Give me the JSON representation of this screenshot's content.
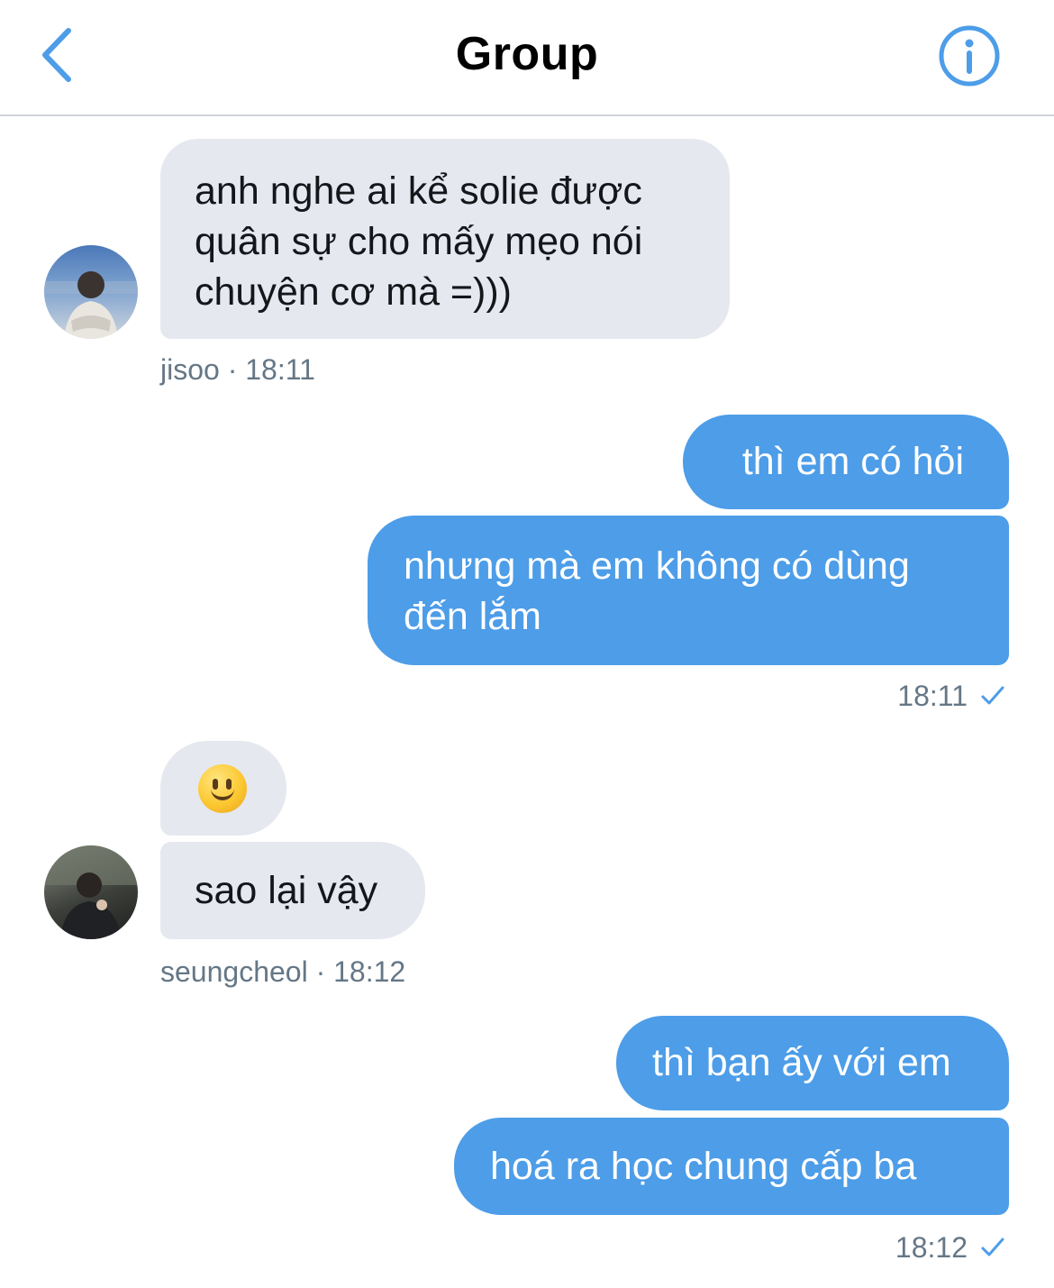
{
  "header": {
    "title": "Group",
    "back_icon": "chevron-left-icon",
    "info_icon": "info-icon",
    "accent": "#4d9de8"
  },
  "messages": [
    {
      "text": "anh nghe ai kể solie được quân sự cho mấy mẹo nói chuyện cơ mà =)))",
      "direction": "incoming"
    },
    {
      "text": "thì em có hỏi",
      "direction": "outgoing"
    },
    {
      "text": "nhưng mà em không có dùng đến lắm",
      "direction": "outgoing"
    },
    {
      "emoji": "slightly-smiling-face-icon",
      "direction": "incoming"
    },
    {
      "text": "sao lại vậy",
      "direction": "incoming"
    },
    {
      "text": "thì bạn ấy với em",
      "direction": "outgoing"
    },
    {
      "text": "hoá ra học chung cấp ba",
      "direction": "outgoing"
    }
  ],
  "meta": {
    "group1": {
      "sender": "jisoo",
      "sep": " · ",
      "time": "18:11"
    },
    "group2": {
      "time": "18:11",
      "icon": "checkmark-icon"
    },
    "group3": {
      "sender": "seungcheol",
      "sep": "  · ",
      "time": "18:12"
    },
    "group4": {
      "time": "18:12",
      "icon": "checkmark-icon"
    }
  },
  "colors": {
    "incoming_bubble": "#e5e8ef",
    "outgoing_bubble": "#4d9de8",
    "meta_text": "#657786"
  }
}
